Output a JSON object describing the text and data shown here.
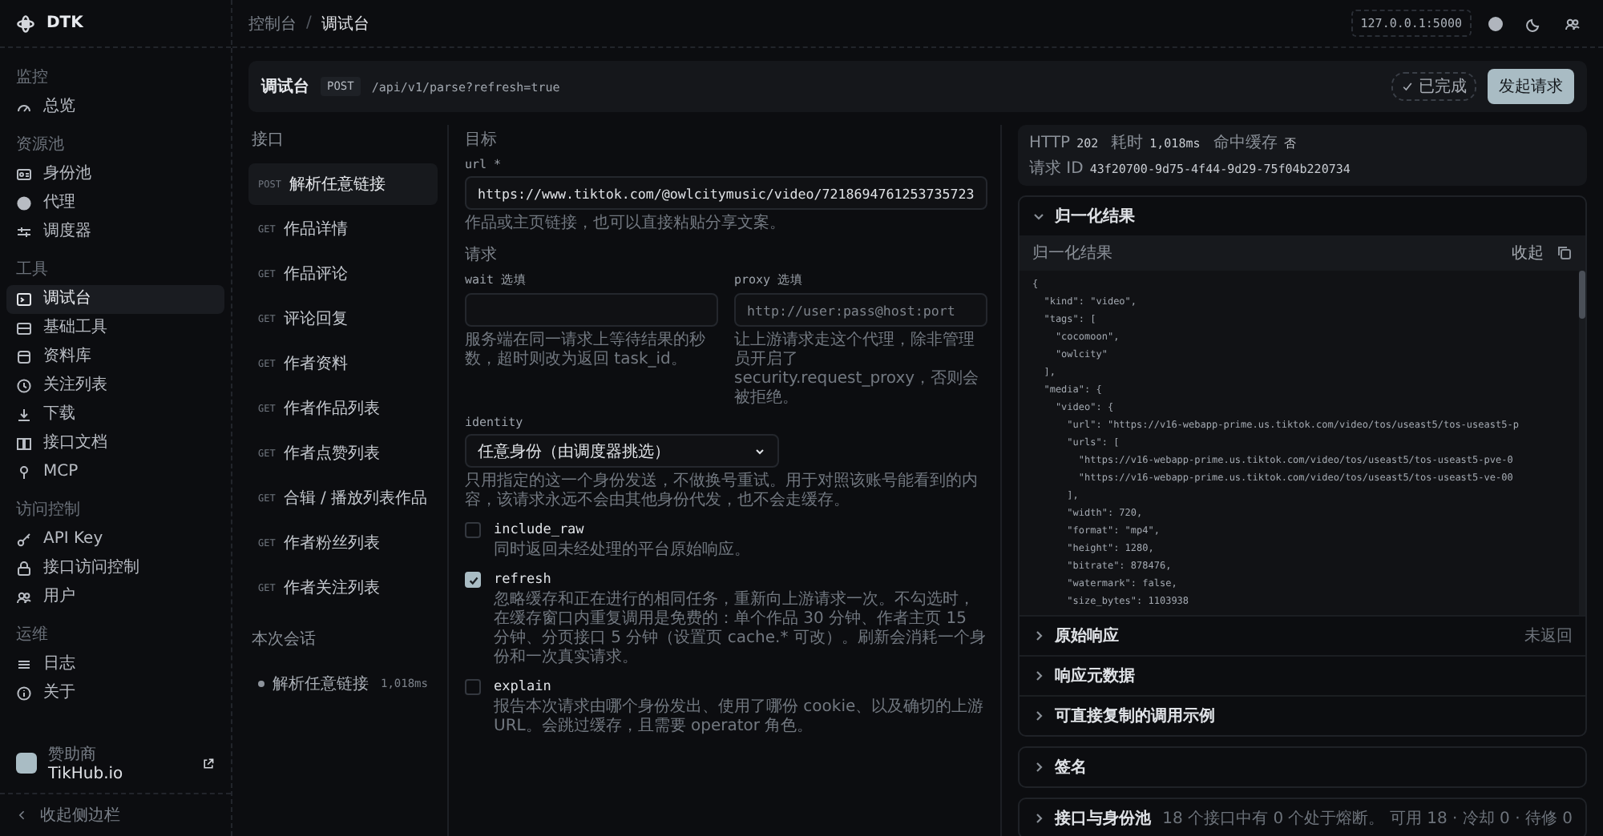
{
  "brand": {
    "name": "DTK"
  },
  "breadcrumb": {
    "parent": "控制台",
    "separator": "/",
    "current": "调试台"
  },
  "topbar": {
    "host": "127.0.0.1:5000"
  },
  "sidebar": {
    "groups": [
      {
        "title": "监控",
        "items": [
          {
            "label": "总览",
            "selected": false
          }
        ]
      },
      {
        "title": "资源池",
        "items": [
          {
            "label": "身份池",
            "selected": false
          },
          {
            "label": "代理",
            "selected": false
          },
          {
            "label": "调度器",
            "selected": false
          }
        ]
      },
      {
        "title": "工具",
        "items": [
          {
            "label": "调试台",
            "selected": true
          },
          {
            "label": "基础工具",
            "selected": false
          },
          {
            "label": "资料库",
            "selected": false
          },
          {
            "label": "关注列表",
            "selected": false
          },
          {
            "label": "下载",
            "selected": false
          },
          {
            "label": "接口文档",
            "selected": false
          },
          {
            "label": "MCP",
            "selected": false
          }
        ]
      },
      {
        "title": "访问控制",
        "items": [
          {
            "label": "API Key",
            "selected": false
          },
          {
            "label": "接口访问控制",
            "selected": false
          },
          {
            "label": "用户",
            "selected": false
          }
        ]
      },
      {
        "title": "运维",
        "items": [
          {
            "label": "日志",
            "selected": false
          },
          {
            "label": "关于",
            "selected": false
          }
        ]
      }
    ],
    "sponsor": {
      "caption": "赞助商",
      "name": "TikHub.io"
    },
    "collapse": "收起侧边栏"
  },
  "request_bar": {
    "title": "调试台",
    "method": "POST",
    "path": "/api/v1/parse?refresh=true",
    "status": "已完成",
    "send_button": "发起请求"
  },
  "endpoints": {
    "title": "接口",
    "items": [
      {
        "method": "POST",
        "label": "解析任意链接",
        "selected": true
      },
      {
        "method": "GET",
        "label": "作品详情",
        "selected": false
      },
      {
        "method": "GET",
        "label": "作品评论",
        "selected": false
      },
      {
        "method": "GET",
        "label": "评论回复",
        "selected": false
      },
      {
        "method": "GET",
        "label": "作者资料",
        "selected": false
      },
      {
        "method": "GET",
        "label": "作者作品列表",
        "selected": false
      },
      {
        "method": "GET",
        "label": "作者点赞列表",
        "selected": false
      },
      {
        "method": "GET",
        "label": "合辑 / 播放列表作品",
        "selected": false
      },
      {
        "method": "GET",
        "label": "作者粉丝列表",
        "selected": false
      },
      {
        "method": "GET",
        "label": "作者关注列表",
        "selected": false
      }
    ],
    "session_title": "本次会话",
    "session": [
      {
        "label": "解析任意链接",
        "time": "1,018ms"
      }
    ]
  },
  "form": {
    "target_heading": "目标",
    "url": {
      "label": "url *",
      "value": "https://www.tiktok.com/@owlcitymusic/video/7218694761253735723",
      "hint": "作品或主页链接，也可以直接粘贴分享文案。"
    },
    "request_heading": "请求",
    "wait": {
      "label": "wait 选填",
      "hint": "服务端在同一请求上等待结果的秒数，超时则改为返回 task_id。"
    },
    "proxy": {
      "label": "proxy 选填",
      "placeholder": "http://user:pass@host:port",
      "hint": "让上游请求走这个代理，除非管理员开启了 security.request_proxy，否则会被拒绝。"
    },
    "identity": {
      "label": "identity",
      "value": "任意身份（由调度器挑选）",
      "hint": "只用指定的这一个身份发送，不做换号重试。用于对照该账号能看到的内容，该请求永远不会由其他身份代发，也不会走缓存。"
    },
    "options": [
      {
        "name": "include_raw",
        "checked": false,
        "hint": "同时返回未经处理的平台原始响应。"
      },
      {
        "name": "refresh",
        "checked": true,
        "hint": "忽略缓存和正在进行的相同任务，重新向上游请求一次。不勾选时，在缓存窗口内重复调用是免费的：单个作品 30 分钟、作者主页 15 分钟、分页接口 5 分钟（设置页 cache.* 可改）。刷新会消耗一个身份和一次真实请求。"
      },
      {
        "name": "explain",
        "checked": false,
        "hint": "报告本次请求由哪个身份发出、使用了哪份 cookie、以及确切的上游 URL。会跳过缓存，且需要 operator 角色。"
      }
    ]
  },
  "result": {
    "status": [
      {
        "label": "HTTP",
        "value": "202"
      },
      {
        "label": "耗时",
        "value": "1,018ms"
      },
      {
        "label": "命中缓存",
        "value": "否"
      },
      {
        "label": "请求 ID",
        "value": "43f20700-9d75-4f44-9d29-75f04b220734"
      }
    ],
    "sections": [
      {
        "title": "归一化结果",
        "expanded": true,
        "panel": {
          "title": "归一化结果",
          "action": "收起",
          "code_lines": [
            "{",
            "  \"kind\": \"video\",",
            "  \"tags\": [",
            "    \"cocomoon\",",
            "    \"owlcity\"",
            "  ],",
            "  \"media\": {",
            "    \"video\": {",
            "      \"url\": \"https://v16-webapp-prime.us.tiktok.com/video/tos/useast5/tos-useast5-p",
            "      \"urls\": [",
            "        \"https://v16-webapp-prime.us.tiktok.com/video/tos/useast5/tos-useast5-pve-0",
            "        \"https://v16-webapp-prime.us.tiktok.com/video/tos/useast5/tos-useast5-ve-00",
            "      ],",
            "      \"width\": 720,",
            "      \"format\": \"mp4\",",
            "      \"height\": 1280,",
            "      \"bitrate\": 878476,",
            "      \"watermark\": false,",
            "      \"size_bytes\": 1103938"
          ]
        }
      },
      {
        "title": "原始响应",
        "expanded": false,
        "note": "未返回"
      },
      {
        "title": "响应元数据",
        "expanded": false
      },
      {
        "title": "可直接复制的调用示例",
        "expanded": false
      }
    ],
    "cards": [
      {
        "title": "签名",
        "expanded": false
      },
      {
        "title": "接口与身份池",
        "expanded": false,
        "note": "18 个接口中有 0 个处于熔断。",
        "stats": "可用 18 · 冷却 0 · 待修 0"
      }
    ]
  }
}
